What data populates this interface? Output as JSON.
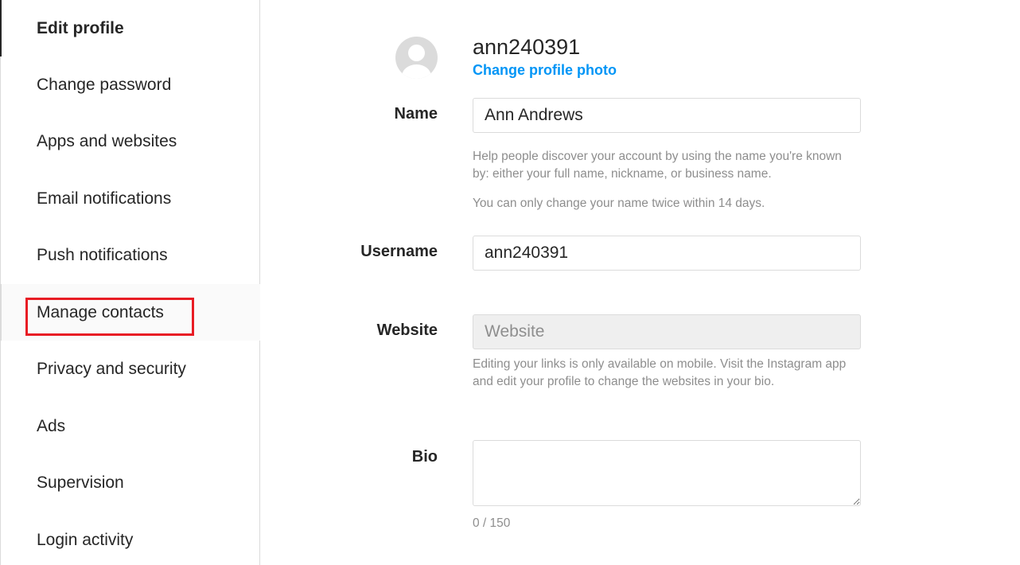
{
  "sidebar": {
    "items": [
      {
        "label": "Edit profile",
        "state": "active"
      },
      {
        "label": "Change password"
      },
      {
        "label": "Apps and websites"
      },
      {
        "label": "Email notifications"
      },
      {
        "label": "Push notifications"
      },
      {
        "label": "Manage contacts",
        "state": "hover",
        "highlighted": true
      },
      {
        "label": "Privacy and security"
      },
      {
        "label": "Ads"
      },
      {
        "label": "Supervision"
      },
      {
        "label": "Login activity"
      }
    ]
  },
  "profile": {
    "username": "ann240391",
    "change_photo_label": "Change profile photo",
    "avatar_icon": "default-user-avatar"
  },
  "form": {
    "name": {
      "label": "Name",
      "value": "Ann Andrews",
      "help1": "Help people discover your account by using the name you're known by: either your full name, nickname, or business name.",
      "help2": "You can only change your name twice within 14 days."
    },
    "username": {
      "label": "Username",
      "value": "ann240391"
    },
    "website": {
      "label": "Website",
      "placeholder": "Website",
      "disabled": true,
      "help": "Editing your links is only available on mobile. Visit the Instagram app and edit your profile to change the websites in your bio."
    },
    "bio": {
      "label": "Bio",
      "value": "",
      "counter": "0 / 150"
    }
  },
  "colors": {
    "link": "#0095f6",
    "highlight_box": "#e81c24",
    "border": "#dbdbdb",
    "muted_text": "#8e8e8e"
  }
}
